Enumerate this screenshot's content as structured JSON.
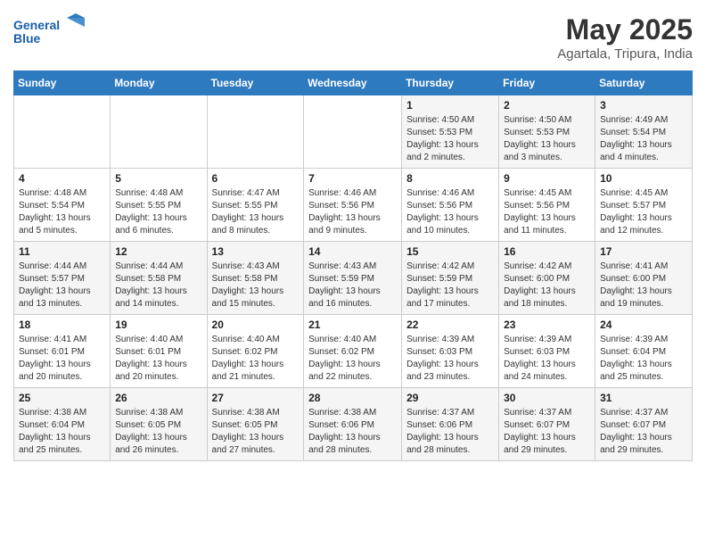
{
  "header": {
    "logo_line1": "General",
    "logo_line2": "Blue",
    "month_year": "May 2025",
    "location": "Agartala, Tripura, India"
  },
  "days_of_week": [
    "Sunday",
    "Monday",
    "Tuesday",
    "Wednesday",
    "Thursday",
    "Friday",
    "Saturday"
  ],
  "weeks": [
    [
      {
        "day": "",
        "info": ""
      },
      {
        "day": "",
        "info": ""
      },
      {
        "day": "",
        "info": ""
      },
      {
        "day": "",
        "info": ""
      },
      {
        "day": "1",
        "info": "Sunrise: 4:50 AM\nSunset: 5:53 PM\nDaylight: 13 hours and 2 minutes."
      },
      {
        "day": "2",
        "info": "Sunrise: 4:50 AM\nSunset: 5:53 PM\nDaylight: 13 hours and 3 minutes."
      },
      {
        "day": "3",
        "info": "Sunrise: 4:49 AM\nSunset: 5:54 PM\nDaylight: 13 hours and 4 minutes."
      }
    ],
    [
      {
        "day": "4",
        "info": "Sunrise: 4:48 AM\nSunset: 5:54 PM\nDaylight: 13 hours and 5 minutes."
      },
      {
        "day": "5",
        "info": "Sunrise: 4:48 AM\nSunset: 5:55 PM\nDaylight: 13 hours and 6 minutes."
      },
      {
        "day": "6",
        "info": "Sunrise: 4:47 AM\nSunset: 5:55 PM\nDaylight: 13 hours and 8 minutes."
      },
      {
        "day": "7",
        "info": "Sunrise: 4:46 AM\nSunset: 5:56 PM\nDaylight: 13 hours and 9 minutes."
      },
      {
        "day": "8",
        "info": "Sunrise: 4:46 AM\nSunset: 5:56 PM\nDaylight: 13 hours and 10 minutes."
      },
      {
        "day": "9",
        "info": "Sunrise: 4:45 AM\nSunset: 5:56 PM\nDaylight: 13 hours and 11 minutes."
      },
      {
        "day": "10",
        "info": "Sunrise: 4:45 AM\nSunset: 5:57 PM\nDaylight: 13 hours and 12 minutes."
      }
    ],
    [
      {
        "day": "11",
        "info": "Sunrise: 4:44 AM\nSunset: 5:57 PM\nDaylight: 13 hours and 13 minutes."
      },
      {
        "day": "12",
        "info": "Sunrise: 4:44 AM\nSunset: 5:58 PM\nDaylight: 13 hours and 14 minutes."
      },
      {
        "day": "13",
        "info": "Sunrise: 4:43 AM\nSunset: 5:58 PM\nDaylight: 13 hours and 15 minutes."
      },
      {
        "day": "14",
        "info": "Sunrise: 4:43 AM\nSunset: 5:59 PM\nDaylight: 13 hours and 16 minutes."
      },
      {
        "day": "15",
        "info": "Sunrise: 4:42 AM\nSunset: 5:59 PM\nDaylight: 13 hours and 17 minutes."
      },
      {
        "day": "16",
        "info": "Sunrise: 4:42 AM\nSunset: 6:00 PM\nDaylight: 13 hours and 18 minutes."
      },
      {
        "day": "17",
        "info": "Sunrise: 4:41 AM\nSunset: 6:00 PM\nDaylight: 13 hours and 19 minutes."
      }
    ],
    [
      {
        "day": "18",
        "info": "Sunrise: 4:41 AM\nSunset: 6:01 PM\nDaylight: 13 hours and 20 minutes."
      },
      {
        "day": "19",
        "info": "Sunrise: 4:40 AM\nSunset: 6:01 PM\nDaylight: 13 hours and 20 minutes."
      },
      {
        "day": "20",
        "info": "Sunrise: 4:40 AM\nSunset: 6:02 PM\nDaylight: 13 hours and 21 minutes."
      },
      {
        "day": "21",
        "info": "Sunrise: 4:40 AM\nSunset: 6:02 PM\nDaylight: 13 hours and 22 minutes."
      },
      {
        "day": "22",
        "info": "Sunrise: 4:39 AM\nSunset: 6:03 PM\nDaylight: 13 hours and 23 minutes."
      },
      {
        "day": "23",
        "info": "Sunrise: 4:39 AM\nSunset: 6:03 PM\nDaylight: 13 hours and 24 minutes."
      },
      {
        "day": "24",
        "info": "Sunrise: 4:39 AM\nSunset: 6:04 PM\nDaylight: 13 hours and 25 minutes."
      }
    ],
    [
      {
        "day": "25",
        "info": "Sunrise: 4:38 AM\nSunset: 6:04 PM\nDaylight: 13 hours and 25 minutes."
      },
      {
        "day": "26",
        "info": "Sunrise: 4:38 AM\nSunset: 6:05 PM\nDaylight: 13 hours and 26 minutes."
      },
      {
        "day": "27",
        "info": "Sunrise: 4:38 AM\nSunset: 6:05 PM\nDaylight: 13 hours and 27 minutes."
      },
      {
        "day": "28",
        "info": "Sunrise: 4:38 AM\nSunset: 6:06 PM\nDaylight: 13 hours and 28 minutes."
      },
      {
        "day": "29",
        "info": "Sunrise: 4:37 AM\nSunset: 6:06 PM\nDaylight: 13 hours and 28 minutes."
      },
      {
        "day": "30",
        "info": "Sunrise: 4:37 AM\nSunset: 6:07 PM\nDaylight: 13 hours and 29 minutes."
      },
      {
        "day": "31",
        "info": "Sunrise: 4:37 AM\nSunset: 6:07 PM\nDaylight: 13 hours and 29 minutes."
      }
    ]
  ]
}
